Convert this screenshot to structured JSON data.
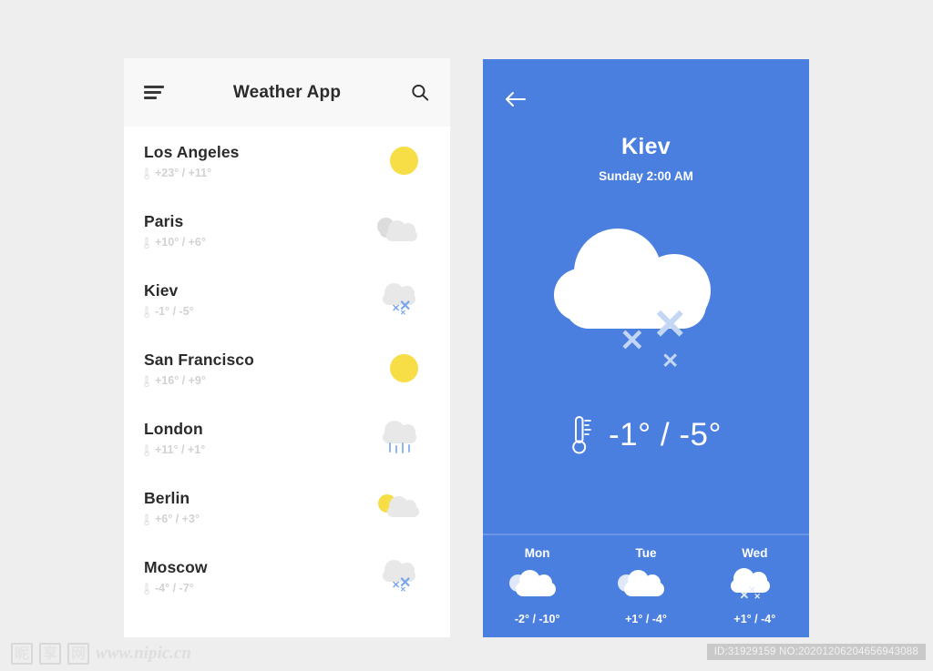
{
  "colors": {
    "accent_blue": "#4a7fe0",
    "sun_yellow": "#f7dd46",
    "cloud_gray": "#e8e8e8",
    "snow_blue": "#78a6e8",
    "page_bg": "#eeeeee"
  },
  "list_screen": {
    "menu_icon": "hamburger-icon",
    "title": "Weather App",
    "search_icon": "search-icon",
    "cities": [
      {
        "name": "Los Angeles",
        "temps": "+23° / +11°",
        "condition": "sunny"
      },
      {
        "name": "Paris",
        "temps": "+10° / +6°",
        "condition": "cloudy"
      },
      {
        "name": "Kiev",
        "temps": "-1° / -5°",
        "condition": "snow"
      },
      {
        "name": "San Francisco",
        "temps": "+16° / +9°",
        "condition": "sunny"
      },
      {
        "name": "London",
        "temps": "+11° / +1°",
        "condition": "rain"
      },
      {
        "name": "Berlin",
        "temps": "+6° / +3°",
        "condition": "partly-cloudy"
      },
      {
        "name": "Moscow",
        "temps": "-4° / -7°",
        "condition": "snow"
      }
    ]
  },
  "detail_screen": {
    "back_icon": "arrow-left-icon",
    "city": "Kiev",
    "datetime": "Sunday 2:00 AM",
    "condition": "snow",
    "temperature": "-1° / -5°",
    "forecast": [
      {
        "day": "Mon",
        "temps": "-2° / -10°",
        "condition": "cloudy"
      },
      {
        "day": "Tue",
        "temps": "+1° / -4°",
        "condition": "cloudy"
      },
      {
        "day": "Wed",
        "temps": "+1° / -4°",
        "condition": "snow"
      }
    ]
  },
  "watermark": {
    "logo_chars": [
      "昵",
      "享",
      "网"
    ],
    "url": "www.nipic.cn",
    "id_text": "ID:31929159 NO:20201206204656943088"
  }
}
